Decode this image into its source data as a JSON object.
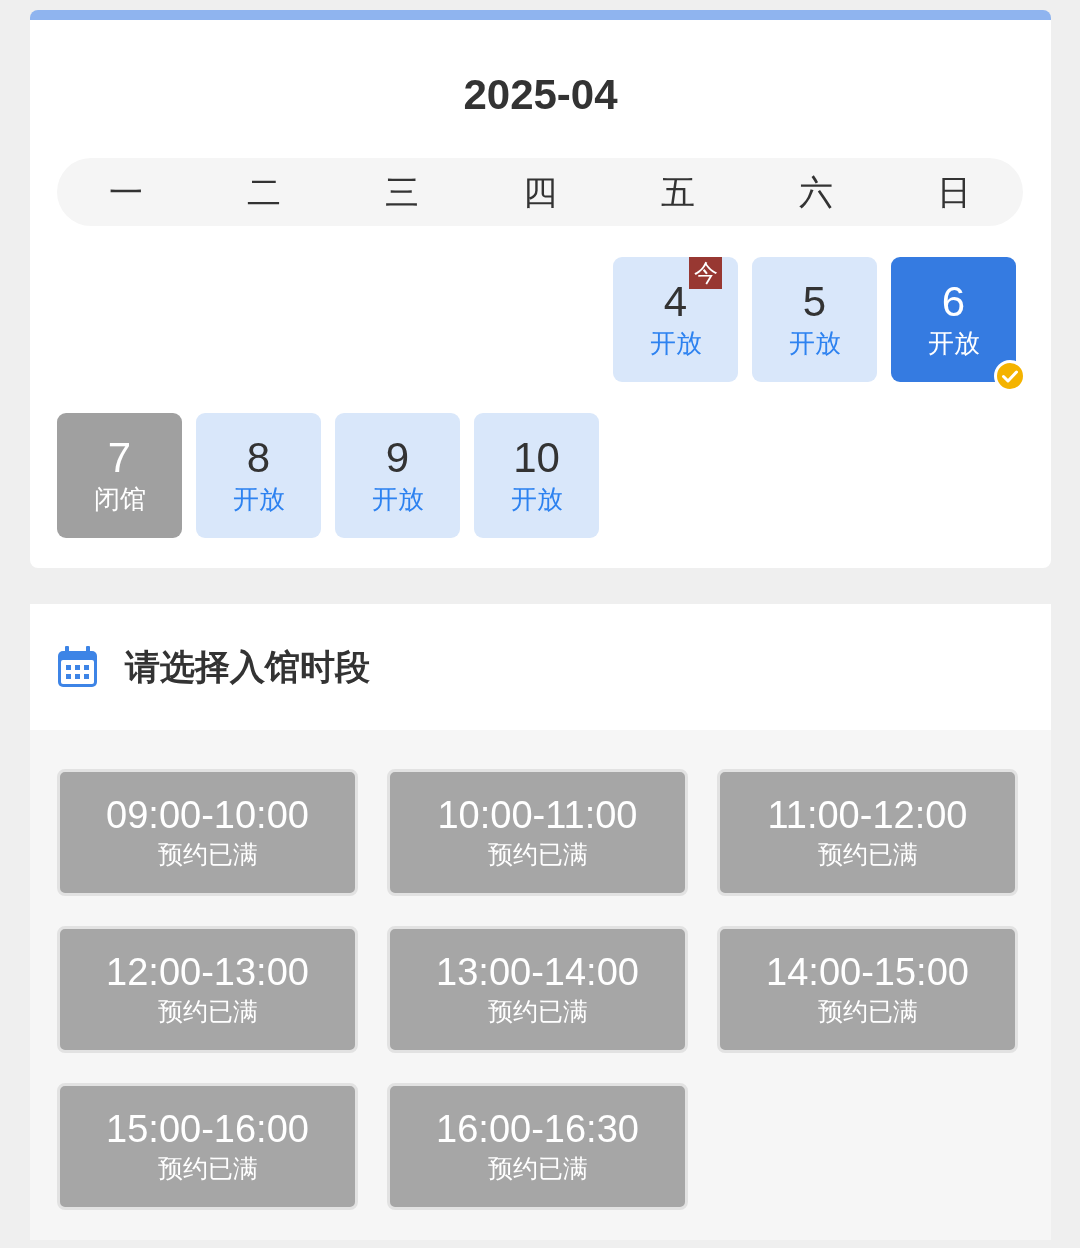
{
  "calendar": {
    "month": "2025-04",
    "weekdays": [
      "一",
      "二",
      "三",
      "四",
      "五",
      "六",
      "日"
    ],
    "days": [
      {
        "kind": "blank"
      },
      {
        "kind": "blank"
      },
      {
        "kind": "blank"
      },
      {
        "kind": "blank"
      },
      {
        "day": "4",
        "status": "开放",
        "kind": "open",
        "selected": false,
        "today_badge": "今"
      },
      {
        "day": "5",
        "status": "开放",
        "kind": "open",
        "selected": false
      },
      {
        "day": "6",
        "status": "开放",
        "kind": "open",
        "selected": true
      },
      {
        "day": "7",
        "status": "闭馆",
        "kind": "closed",
        "selected": false
      },
      {
        "day": "8",
        "status": "开放",
        "kind": "open",
        "selected": false
      },
      {
        "day": "9",
        "status": "开放",
        "kind": "open",
        "selected": false
      },
      {
        "day": "10",
        "status": "开放",
        "kind": "open",
        "selected": false
      }
    ]
  },
  "time_slots": {
    "title": "请选择入馆时段",
    "slots": [
      {
        "time": "09:00-10:00",
        "status": "预约已满",
        "available": false
      },
      {
        "time": "10:00-11:00",
        "status": "预约已满",
        "available": false
      },
      {
        "time": "11:00-12:00",
        "status": "预约已满",
        "available": false
      },
      {
        "time": "12:00-13:00",
        "status": "预约已满",
        "available": false
      },
      {
        "time": "13:00-14:00",
        "status": "预约已满",
        "available": false
      },
      {
        "time": "14:00-15:00",
        "status": "预约已满",
        "available": false
      },
      {
        "time": "15:00-16:00",
        "status": "预约已满",
        "available": false
      },
      {
        "time": "16:00-16:30",
        "status": "预约已满",
        "available": false
      }
    ]
  }
}
